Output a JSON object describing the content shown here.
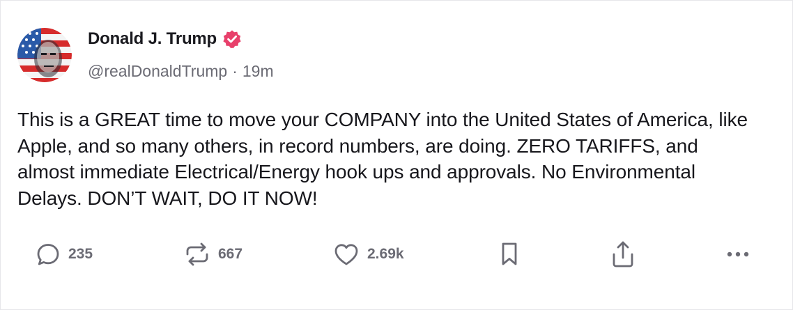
{
  "post": {
    "author": {
      "display_name": "Donald J. Trump",
      "handle": "@realDonaldTrump",
      "verified": true,
      "avatar_icon": "avatar-flag-portrait"
    },
    "separator": "·",
    "time_ago": "19m",
    "text": "This is a GREAT time to move your COMPANY into the United States of America, like Apple, and so many others, in record numbers, are doing. ZERO TARIFFS, and almost immediate Electrical/Energy hook ups and approvals. No Environmental Delays. DON’T WAIT, DO IT NOW!"
  },
  "actions": {
    "replies": {
      "icon": "reply-icon",
      "count": "235"
    },
    "retruths": {
      "icon": "retruth-icon",
      "count": "667"
    },
    "likes": {
      "icon": "heart-icon",
      "count": "2.69k"
    },
    "bookmark": {
      "icon": "bookmark-icon"
    },
    "share": {
      "icon": "share-icon"
    },
    "more": {
      "icon": "more-icon"
    }
  },
  "colors": {
    "verified_badge": "#e8406b",
    "icon_gray": "#6b6b74",
    "text": "#17171c",
    "border": "#e6e6ea"
  }
}
